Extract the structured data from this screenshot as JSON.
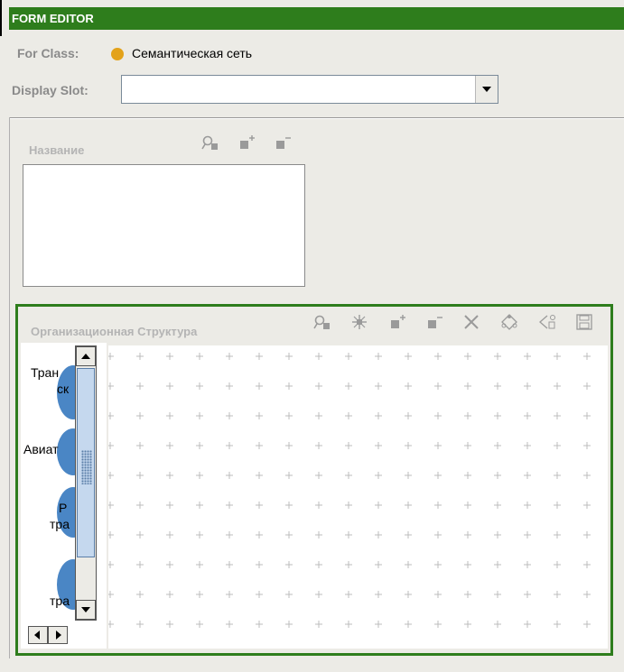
{
  "window": {
    "title": "FORM EDITOR"
  },
  "header": {
    "for_class_label": "For Class:",
    "for_class_value": "Семантическая сеть",
    "display_slot_label": "Display Slot:",
    "display_slot_value": ""
  },
  "name_widget": {
    "label": "Название",
    "toolbar": [
      "view-icon",
      "add-icon",
      "remove-icon"
    ]
  },
  "org_widget": {
    "label": "Организационная Структура",
    "toolbar": [
      "view-icon",
      "zoom-icon",
      "add-icon",
      "remove-icon",
      "delete-icon",
      "layout-icon",
      "connect-icon",
      "save-icon"
    ],
    "node_labels": [
      "Тран",
      "ск",
      "Авиат",
      "Р",
      "тра",
      "тра"
    ]
  },
  "colors": {
    "title_bar": "#2e7d1c",
    "accent_dot": "#e3a21a",
    "node": "#4a86c5",
    "border": "#2e7d1c"
  }
}
